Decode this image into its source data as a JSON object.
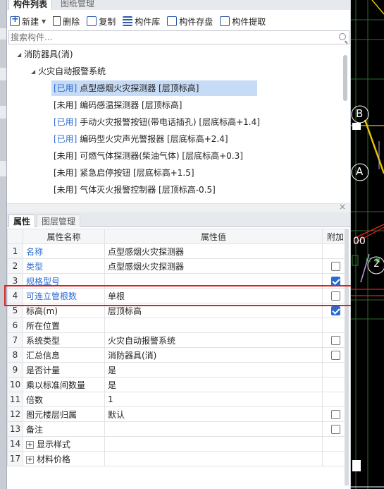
{
  "top_panel": {
    "tabs": [
      "构件列表",
      "图纸管理"
    ],
    "toolbar": {
      "new": "新建",
      "delete": "删除",
      "copy": "复制",
      "library": "构件库",
      "store": "构件存盘",
      "extract": "构件提取"
    },
    "search_placeholder": "搜索构件...",
    "tree": {
      "root": "消防器具(消)",
      "group": "火灾自动报警系统",
      "items": [
        {
          "status": "[已用]",
          "text": "点型感烟火灾探测器 [层顶标高]"
        },
        {
          "status": "[未用]",
          "text": "编码感温探测器 [层顶标高]"
        },
        {
          "status": "[已用]",
          "text": "手动火灾报警按钮(带电话插孔) [层底标高+1.4]"
        },
        {
          "status": "[已用]",
          "text": "编码型火灾声光警报器 [层底标高+2.4]"
        },
        {
          "status": "[未用]",
          "text": "可燃气体探测器(柴油气体) [层底标高+0.3]"
        },
        {
          "status": "[未用]",
          "text": "紧急启停按钮 [层底标高+1.5]"
        },
        {
          "status": "[未用]",
          "text": "气体灭火报警控制器 [层顶标高-0.5]"
        }
      ]
    }
  },
  "bottom_panel": {
    "tabs": [
      "属性",
      "图层管理"
    ],
    "columns": [
      "属性名称",
      "属性值",
      "附加"
    ],
    "rows": [
      {
        "idx": "1",
        "name": "名称",
        "value": "点型感烟火灾探测器",
        "checkbox": "none"
      },
      {
        "idx": "2",
        "name": "类型",
        "value": "点型感烟火灾探测器",
        "checkbox": "unchecked"
      },
      {
        "idx": "3",
        "name": "规格型号",
        "value": "",
        "checkbox": "checked"
      },
      {
        "idx": "4",
        "name": "可连立管根数",
        "value": "单根",
        "checkbox": "unchecked"
      },
      {
        "idx": "5",
        "name": "标高(m)",
        "value": "层顶标高",
        "checkbox": "checked"
      },
      {
        "idx": "6",
        "name": "所在位置",
        "value": "",
        "checkbox": "none"
      },
      {
        "idx": "7",
        "name": "系统类型",
        "value": "火灾自动报警系统",
        "checkbox": "unchecked"
      },
      {
        "idx": "8",
        "name": "汇总信息",
        "value": "消防器具(消)",
        "checkbox": "unchecked"
      },
      {
        "idx": "9",
        "name": "是否计量",
        "value": "是",
        "checkbox": "none"
      },
      {
        "idx": "10",
        "name": "乘以标准间数量",
        "value": "是",
        "checkbox": "none"
      },
      {
        "idx": "11",
        "name": "倍数",
        "value": "1",
        "checkbox": "none"
      },
      {
        "idx": "12",
        "name": "图元楼层归属",
        "value": "默认",
        "checkbox": "unchecked"
      },
      {
        "idx": "13",
        "name": "备注",
        "value": "",
        "checkbox": "unchecked"
      },
      {
        "idx": "14",
        "name": "显示样式",
        "value": "",
        "checkbox": "none",
        "expandable": "+"
      },
      {
        "idx": "17",
        "name": "材料价格",
        "value": "",
        "checkbox": "none",
        "expandable": "+"
      }
    ]
  },
  "cad": {
    "labels": [
      "B",
      "A",
      "00",
      "2"
    ]
  },
  "colors": {
    "accent": "#2a6ad1",
    "highlight": "#e02020",
    "selected": "#c6dbf5"
  }
}
